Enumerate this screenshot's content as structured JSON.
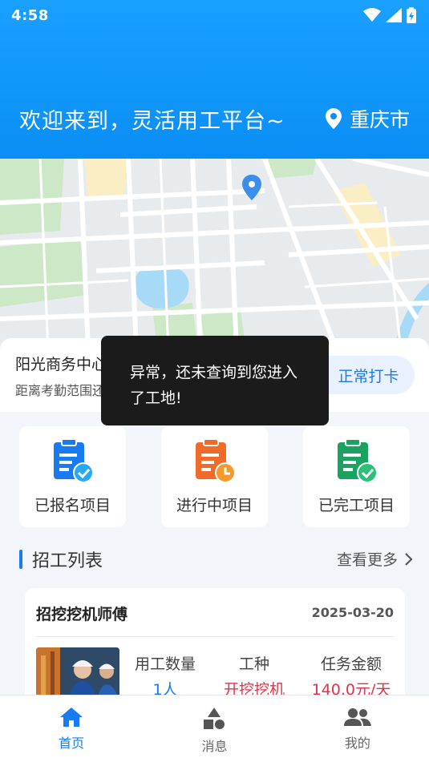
{
  "status_bar": {
    "time": "4:58"
  },
  "header": {
    "welcome": "欢迎来到，灵活用工平台~",
    "city": "重庆市",
    "location_icon": "location-pin-icon"
  },
  "location": {
    "name": "阳光商务中心",
    "distance_text": "距离考勤范围还有600米",
    "clockin_label": "正常打卡"
  },
  "toast": {
    "message": "异常，还未查询到您进入了工地!"
  },
  "projects": [
    {
      "label": "已报名项目",
      "icon": "registered-clipboard-icon",
      "color": "#1a7bf0"
    },
    {
      "label": "进行中项目",
      "icon": "in-progress-clipboard-icon",
      "color": "#f06a2a"
    },
    {
      "label": "已完工项目",
      "icon": "completed-clipboard-icon",
      "color": "#1aa360"
    }
  ],
  "section": {
    "title": "招工列表",
    "more_label": "查看更多"
  },
  "job": {
    "title": "招挖挖机师傅",
    "date": "2025-03-20",
    "headcount_label": "用工数量",
    "headcount_value": "1人",
    "type_label": "工种",
    "type_value": "开挖挖机",
    "amount_label": "任务金额",
    "amount_value": "140.0元/天"
  },
  "nav": [
    {
      "label": "首页",
      "icon": "home-icon",
      "active": true
    },
    {
      "label": "消息",
      "icon": "shapes-icon",
      "active": false
    },
    {
      "label": "我的",
      "icon": "people-icon",
      "active": false
    }
  ],
  "colors": {
    "primary": "#1a7bf0",
    "header": "#0a8ef5",
    "accent_red": "#e0334a"
  }
}
